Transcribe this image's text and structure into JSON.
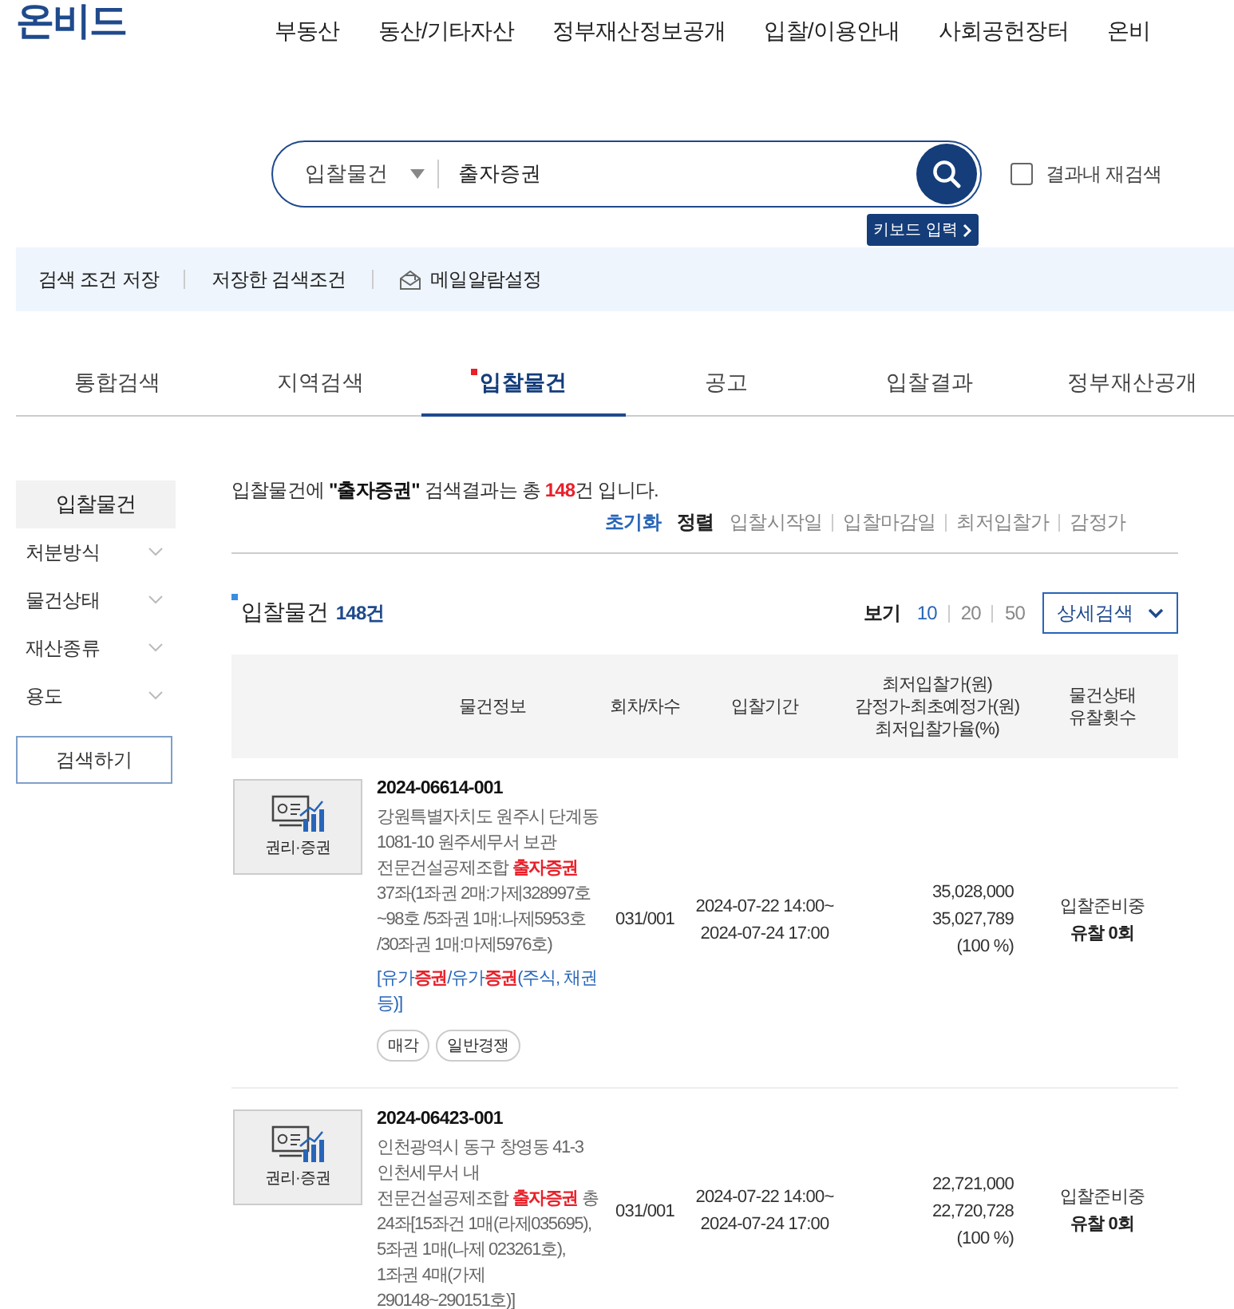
{
  "logo": "온비드",
  "nav": [
    "부동산",
    "동산/기타자산",
    "정부재산정보공개",
    "입찰/이용안내",
    "사회공헌장터",
    "온비"
  ],
  "search": {
    "category": "입찰물건",
    "query": "출자증권",
    "keyboard_button": "키보드 입력",
    "research": {
      "label": "결과내 재검색",
      "checked": false
    }
  },
  "toolbar": [
    "검색 조건 저장",
    "저장한 검색조건",
    "메일알람설정"
  ],
  "tabs": [
    {
      "label": "통합검색",
      "selected": false
    },
    {
      "label": "지역검색",
      "selected": false
    },
    {
      "label": "입찰물건",
      "selected": true
    },
    {
      "label": "공고",
      "selected": false
    },
    {
      "label": "입찰결과",
      "selected": false
    },
    {
      "label": "정부재산공개",
      "selected": false
    }
  ],
  "sidebar": {
    "title": "입찰물건",
    "filters": [
      "처분방식",
      "물건상태",
      "재산종류",
      "용도"
    ],
    "search_button": "검색하기"
  },
  "summary": "입찰물건에 **\"출자증권\"** 검색결과는 총 **148**건 입니다.",
  "sort": {
    "reset": "초기화",
    "label": "정렬",
    "options": [
      "입찰시작일",
      "입찰마감일",
      "최저입찰가",
      "감정가"
    ]
  },
  "list": {
    "title": "입찰물건",
    "count": "148건",
    "view_label": "보기",
    "page_sizes": [
      {
        "label": "10",
        "selected": true
      },
      {
        "label": "20",
        "selected": false
      },
      {
        "label": "50",
        "selected": false
      }
    ],
    "detail_button": "상세검색"
  },
  "columns": [
    "물건정보",
    "회차/차수",
    "입찰기간",
    "최저입찰가(원)\n감정가-최초예정가(원)\n최저입찰가율(%)",
    "물건상태\n유찰횟수"
  ],
  "rows": [
    {
      "thumb_label": "권리·증권",
      "id": "2024-06614-001",
      "description": "강원특별자치도 원주시 단계동 1081-10 원주세무서 보관 전문건설공제조합 **출자증권** 37좌(1좌권 2매:가제328997호~98호 /5좌권 1매:나제5953호 /30좌권 1매:마제5976호)",
      "category": "[유가**증권**/유가**증권**(주식, 채권 등)]",
      "tags": [
        "매각",
        "일반경쟁"
      ],
      "round": "031/001",
      "period_start": "2024-07-22 14:00~",
      "period_end": "2024-07-24 17:00",
      "min_price": "35,028,000",
      "appraisal": "35,027,789",
      "rate": "(100 %)",
      "status": "입찰준비중",
      "fail_count": "유찰 0회"
    },
    {
      "thumb_label": "권리·증권",
      "id": "2024-06423-001",
      "description": "인천광역시 동구 창영동 41-3 인천세무서 내 전문건설공제조합 **출자증권** 총 24좌[15좌건 1매(라제035695), 5좌권 1매(나제 023261호), 1좌권 4매(가제 290148~290151호)]",
      "round": "031/001",
      "period_start": "2024-07-22 14:00~",
      "period_end": "2024-07-24 17:00",
      "min_price": "22,721,000",
      "appraisal": "22,720,728",
      "rate": "(100 %)",
      "status": "입찰준비중",
      "fail_count": "유찰 0회"
    }
  ]
}
